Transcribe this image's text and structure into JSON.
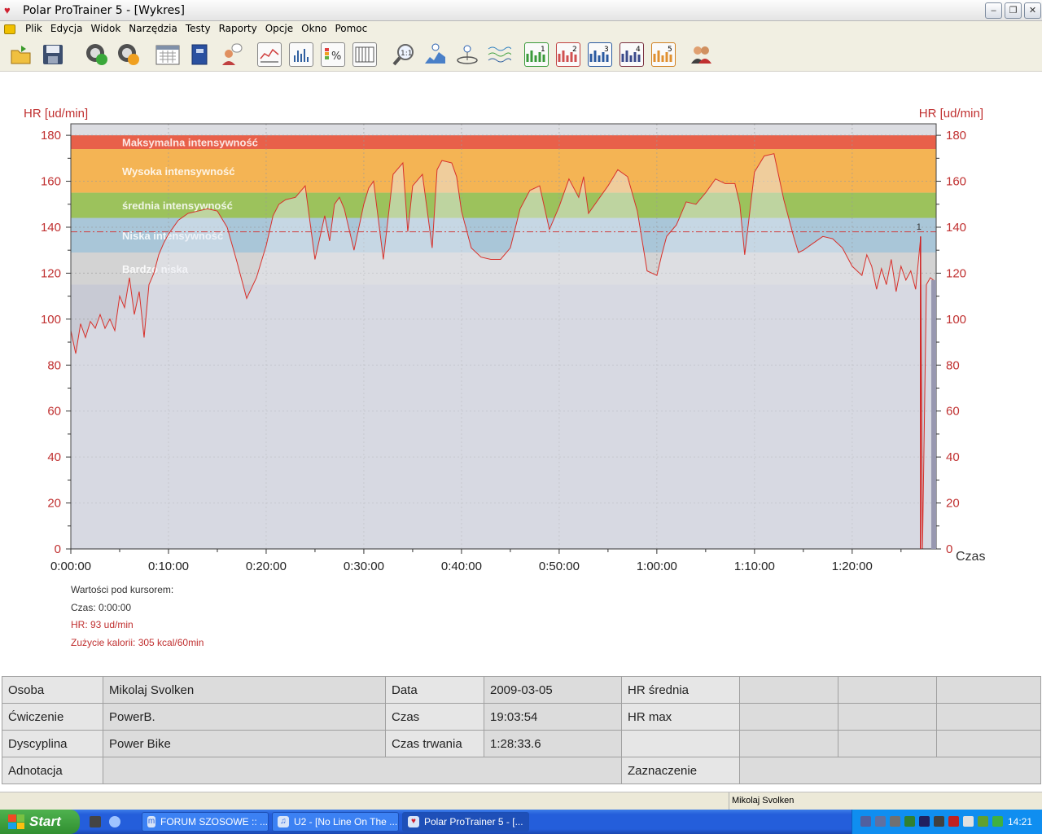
{
  "window": {
    "title": "Polar ProTrainer 5 - [Wykres]"
  },
  "menu": [
    "Plik",
    "Edycja",
    "Widok",
    "Narzędzia",
    "Testy",
    "Raporty",
    "Opcje",
    "Okno",
    "Pomoc"
  ],
  "toolbar": {
    "icons": [
      "open-folder-icon",
      "save-icon",
      "sync-icon",
      "settings-gear-icon",
      "calendar-icon",
      "book-icon",
      "person-icon",
      "line-chart-icon",
      "bar-chart-icon",
      "percent-chart-icon",
      "table-icon",
      "zoom-icon",
      "info-chart-icon",
      "lap-info-icon",
      "graph-select-icon",
      "chart-1-icon",
      "chart-2-icon",
      "chart-3-icon",
      "chart-4-icon",
      "chart-5-icon",
      "users-icon"
    ],
    "chart_numbers": [
      "1",
      "2",
      "3",
      "4",
      "5"
    ]
  },
  "chart_data": {
    "type": "area",
    "ylabel_left": "HR [ud/min]",
    "ylabel_right": "HR [ud/min]",
    "xlabel": "Czas",
    "ylim": [
      0,
      185
    ],
    "y_ticks": [
      0,
      20,
      40,
      60,
      80,
      100,
      120,
      140,
      160,
      180
    ],
    "x_ticks": [
      "0:00:00",
      "0:10:00",
      "0:20:00",
      "0:30:00",
      "0:40:00",
      "0:50:00",
      "1:00:00",
      "1:10:00",
      "1:20:00"
    ],
    "x_range_min": [
      0,
      88.6
    ],
    "zones": [
      {
        "name": "Maksymalna intensywność",
        "from": 174,
        "to": 180,
        "color": "#e8604a"
      },
      {
        "name": "Wysoka intensywność",
        "from": 155,
        "to": 174,
        "color": "#f4b454"
      },
      {
        "name": "średnia intensywność",
        "from": 144,
        "to": 155,
        "color": "#9cc25c"
      },
      {
        "name": "Niska intensywność",
        "from": 129,
        "to": 144,
        "color": "#a9c6d8"
      },
      {
        "name": "Bardzo niska",
        "from": 115,
        "to": 129,
        "color": "#d3d3d3"
      }
    ],
    "average_hr": 138,
    "marker_label": "1",
    "marker_time_min": 87,
    "series": [
      {
        "x": [
          0,
          0.5,
          1,
          1.5,
          2,
          2.5,
          3,
          3.5,
          4,
          4.5,
          5,
          5.5,
          6,
          6.5,
          7,
          7.5,
          8,
          8.5,
          9,
          9.5,
          10,
          11,
          12,
          13,
          14,
          15,
          16,
          17,
          18,
          19,
          20,
          20.7,
          21.3,
          22,
          23,
          24,
          25,
          26,
          26.5,
          27,
          27.5,
          28,
          29,
          30,
          30.5,
          31,
          32,
          33,
          34,
          34.5,
          35,
          36,
          37,
          37.5,
          38,
          39,
          39.5,
          40,
          41,
          42,
          43,
          44,
          45,
          46,
          47,
          48,
          49,
          50,
          51,
          52,
          52.5,
          53,
          54,
          55,
          56,
          57,
          58,
          59,
          60,
          60.5,
          61,
          62,
          63,
          64,
          65,
          66,
          67,
          68,
          68.5,
          69,
          70,
          71,
          72,
          73,
          74,
          74.5,
          75,
          76,
          77,
          78,
          79,
          80,
          81,
          81.5,
          82,
          82.5,
          83,
          83.5,
          84,
          84.5,
          85,
          85.5,
          86,
          86.5,
          87,
          87.2,
          87.6,
          88,
          88.6
        ],
        "values": [
          95,
          85,
          98,
          92,
          99,
          96,
          102,
          96,
          100,
          95,
          110,
          105,
          118,
          102,
          112,
          92,
          115,
          120,
          128,
          133,
          137,
          143,
          146,
          147,
          148,
          147,
          140,
          125,
          109,
          118,
          132,
          145,
          150,
          152,
          153,
          158,
          126,
          145,
          134,
          150,
          153,
          148,
          130,
          150,
          157,
          160,
          126,
          163,
          168,
          138,
          158,
          163,
          131,
          165,
          169,
          168,
          162,
          147,
          131,
          127,
          126,
          126,
          131,
          148,
          156,
          158,
          139,
          149,
          161,
          153,
          162,
          146,
          152,
          158,
          165,
          162,
          147,
          121,
          119,
          128,
          136,
          141,
          151,
          150,
          155,
          161,
          159,
          159,
          150,
          128,
          164,
          171,
          172,
          152,
          136,
          129,
          130,
          133,
          136,
          135,
          131,
          123,
          119,
          128,
          123,
          113,
          122,
          115,
          126,
          112,
          123,
          117,
          121,
          113,
          135,
          0,
          115,
          118,
          116
        ]
      }
    ]
  },
  "cursor": {
    "title": "Wartości pod kursorem:",
    "time": "Czas: 0:00:00",
    "hr": "HR: 93 ud/min",
    "calories": "Zużycie kalorii: 305 kcal/60min"
  },
  "summary": {
    "person_label": "Osoba",
    "person": "Mikolaj Svolken",
    "exercise_label": "Ćwiczenie",
    "exercise": "PowerB.",
    "discipline_label": "Dyscyplina",
    "discipline": "Power Bike",
    "note_label": "Adnotacja",
    "date_label": "Data",
    "date": "2009-03-05",
    "time_label": "Czas",
    "time": "19:03:54",
    "duration_label": "Czas trwania",
    "duration": "1:28:33.6",
    "hr_avg_label": "HR średnia",
    "hr_max_label": "HR max",
    "selection_label": "Zaznaczenie"
  },
  "status": {
    "user": "Mikolaj Svolken"
  },
  "taskbar": {
    "start": "Start",
    "tasks": [
      "FORUM SZOSOWE :: ...",
      "U2 - [No Line On The ...",
      "Polar ProTrainer 5 - [..."
    ],
    "clock": "14:21"
  }
}
